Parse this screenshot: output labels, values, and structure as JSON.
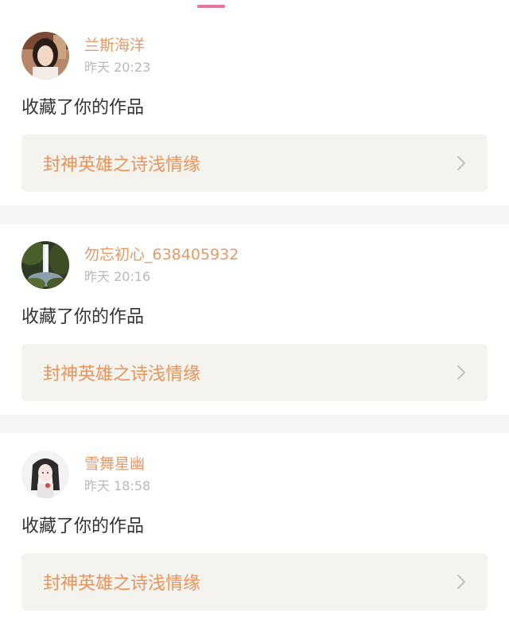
{
  "colors": {
    "accent_pink": "#e9749e",
    "username": "#e89a66",
    "work_title": "#e8945b",
    "time": "#b9b9b9",
    "work_box_bg": "#f4f3ee",
    "separator": "#f7f5f5"
  },
  "notifications": [
    {
      "username": "兰斯海洋",
      "time": "昨天 20:23",
      "action": "收藏了你的作品",
      "work_title": "封神英雄之诗浅情缘",
      "avatar_icon": "avatar-portrait-photo"
    },
    {
      "username": "勿忘初心_638405932",
      "time": "昨天 20:16",
      "action": "收藏了你的作品",
      "work_title": "封神英雄之诗浅情缘",
      "avatar_icon": "avatar-waterfall-photo"
    },
    {
      "username": "雪舞星幽",
      "time": "昨天 18:58",
      "action": "收藏了你的作品",
      "work_title": "封神英雄之诗浅情缘",
      "avatar_icon": "avatar-illustration-girl"
    }
  ]
}
